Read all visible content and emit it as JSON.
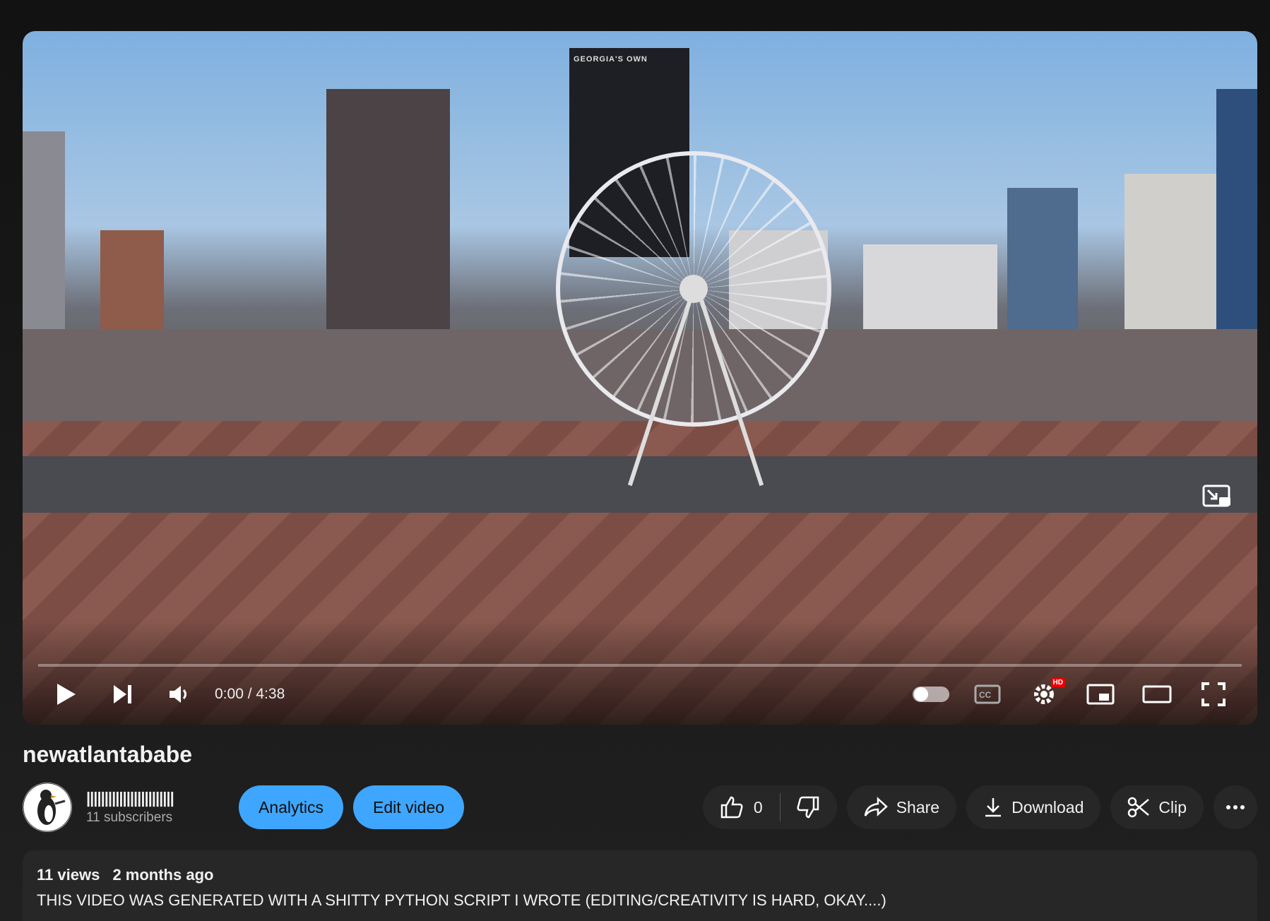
{
  "video": {
    "tower_sign": "GEORGIA'S OWN",
    "current_time": "0:00",
    "duration": "4:38",
    "time_display": "0:00 / 4:38",
    "progress_fraction": 0.0,
    "quality_badge": "HD"
  },
  "title": "newatlantababe",
  "owner": {
    "channel_name": "||||||||||||||||||||||||",
    "subscribers": "11 subscribers"
  },
  "actions": {
    "analytics_label": "Analytics",
    "edit_label": "Edit video",
    "like_count": "0",
    "share_label": "Share",
    "download_label": "Download",
    "clip_label": "Clip"
  },
  "description": {
    "views": "11 views",
    "date": "2 months ago",
    "text": "THIS VIDEO WAS GENERATED WITH A SHITTY PYTHON SCRIPT I WROTE (EDITING/CREATIVITY IS HARD, OKAY....)"
  },
  "colors": {
    "accent_blue": "#3ea6ff",
    "progress_red": "#ff0000",
    "background": "#0f0f0f",
    "button_grey": "#272727"
  },
  "icons": [
    "play-icon",
    "next-icon",
    "volume-icon",
    "autoplay-toggle",
    "captions-icon",
    "settings-icon",
    "miniplayer-icon",
    "theater-icon",
    "fullscreen-icon",
    "like-icon",
    "dislike-icon",
    "share-icon",
    "download-icon",
    "clip-icon",
    "more-icon"
  ]
}
